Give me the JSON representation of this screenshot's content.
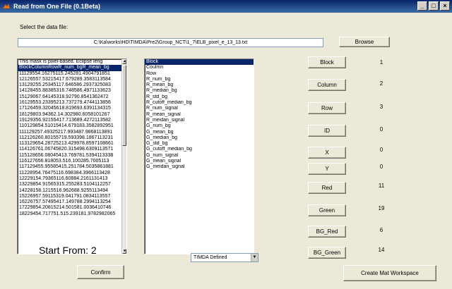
{
  "window": {
    "title": "Read from One File (0.1Beta)",
    "controls": [
      "_",
      "□",
      "×"
    ]
  },
  "file": {
    "select_label": "Select the data file:",
    "path": "C:\\Ka\\works\\HD\\TIMDA\\Pre2\\Group_NCT\\1_7\\ELB_pixel_e_13_13.txt",
    "browse_label": "Browse"
  },
  "data_list": {
    "rows": [
      "This mask is pixel-based. Eclipse    leng",
      "BlockColumnRowR_num_bgR_mean_bg",
      "11129554.16275115.245281.4904791851",
      "12126557.53215417.679289.3583113584",
      "13129255.25345117.646586.2937325083",
      "14128455.88385316.748586.4971133623",
      "15129067.64145318.92790.8541362472",
      "16129553.23395213.737279.4744113856",
      "17126459.32045618.819693.6391134315",
      "18129803.94362.14.302980.6058101267",
      "19129356.92155417.713689.4272113582",
      "110129854.51015414.679183.3582892951",
      "111129257.49325217.993487.9868113891",
      "112126260.80155719.593398.1867113231",
      "113129654.28725213.429978.8597108661",
      "114126761.06745820.315498.6309113571",
      "115128656.08045413.769781.5394113338",
      "116127656.818053.516.100285.7005113",
      "117129455.95585415.251784.5035861881",
      "11228954.76475116.698384.3966113428",
      "12229154.79365116.60884.2161131413",
      "13229854.91565315.255283.5104112257",
      "14228158.1215516.962688.9255113494",
      "15226957.59115319.041791.0834113557",
      "16226757.57495417.149788.2994113254",
      "17229854.20815214.501581.0036410746",
      "18229454.717751.515.239181.9782982065"
    ],
    "selected_index": 1
  },
  "start_from": {
    "label": "Start From:",
    "value": "2"
  },
  "confirm_label": "Confirm",
  "field_list": {
    "rows": [
      "Block",
      "Coulmn",
      "Row",
      "R_num_bg",
      "R_mean_bg",
      "R_median_bg",
      "R_std_bg",
      "R_cutoff_median_bg",
      "R_num_signal",
      "R_mean_signal",
      "R_meidan_signal",
      "G_num_bg",
      "G_mean_bg",
      "G_median_bg",
      "G_std_bg",
      "G_cutoff_median_bg",
      "G_num_signal",
      "G_mean_signal",
      "G_meidan_signal"
    ],
    "selected_index": 0
  },
  "format_select": {
    "value": "TIMDA Defined"
  },
  "mappings": [
    {
      "label": "Block",
      "value": "1"
    },
    {
      "label": "Column",
      "value": "2"
    },
    {
      "label": "Row",
      "value": "3"
    },
    {
      "label": "ID",
      "value": "0"
    },
    {
      "label": "X",
      "value": "0"
    },
    {
      "label": "Y",
      "value": "0"
    },
    {
      "label": "Red",
      "value": "11"
    },
    {
      "label": "Green",
      "value": "19"
    },
    {
      "label": "BG_Red",
      "value": "6"
    },
    {
      "label": "BG_Green",
      "value": "14"
    }
  ],
  "create_label": "Create Mat Workspace",
  "colors": {
    "titlebar": "#0a246a",
    "selection": "#0a246a",
    "background": "#ece9d8"
  },
  "icons": {
    "app": "matlab-icon",
    "dropdown": "chevron-down-icon"
  }
}
